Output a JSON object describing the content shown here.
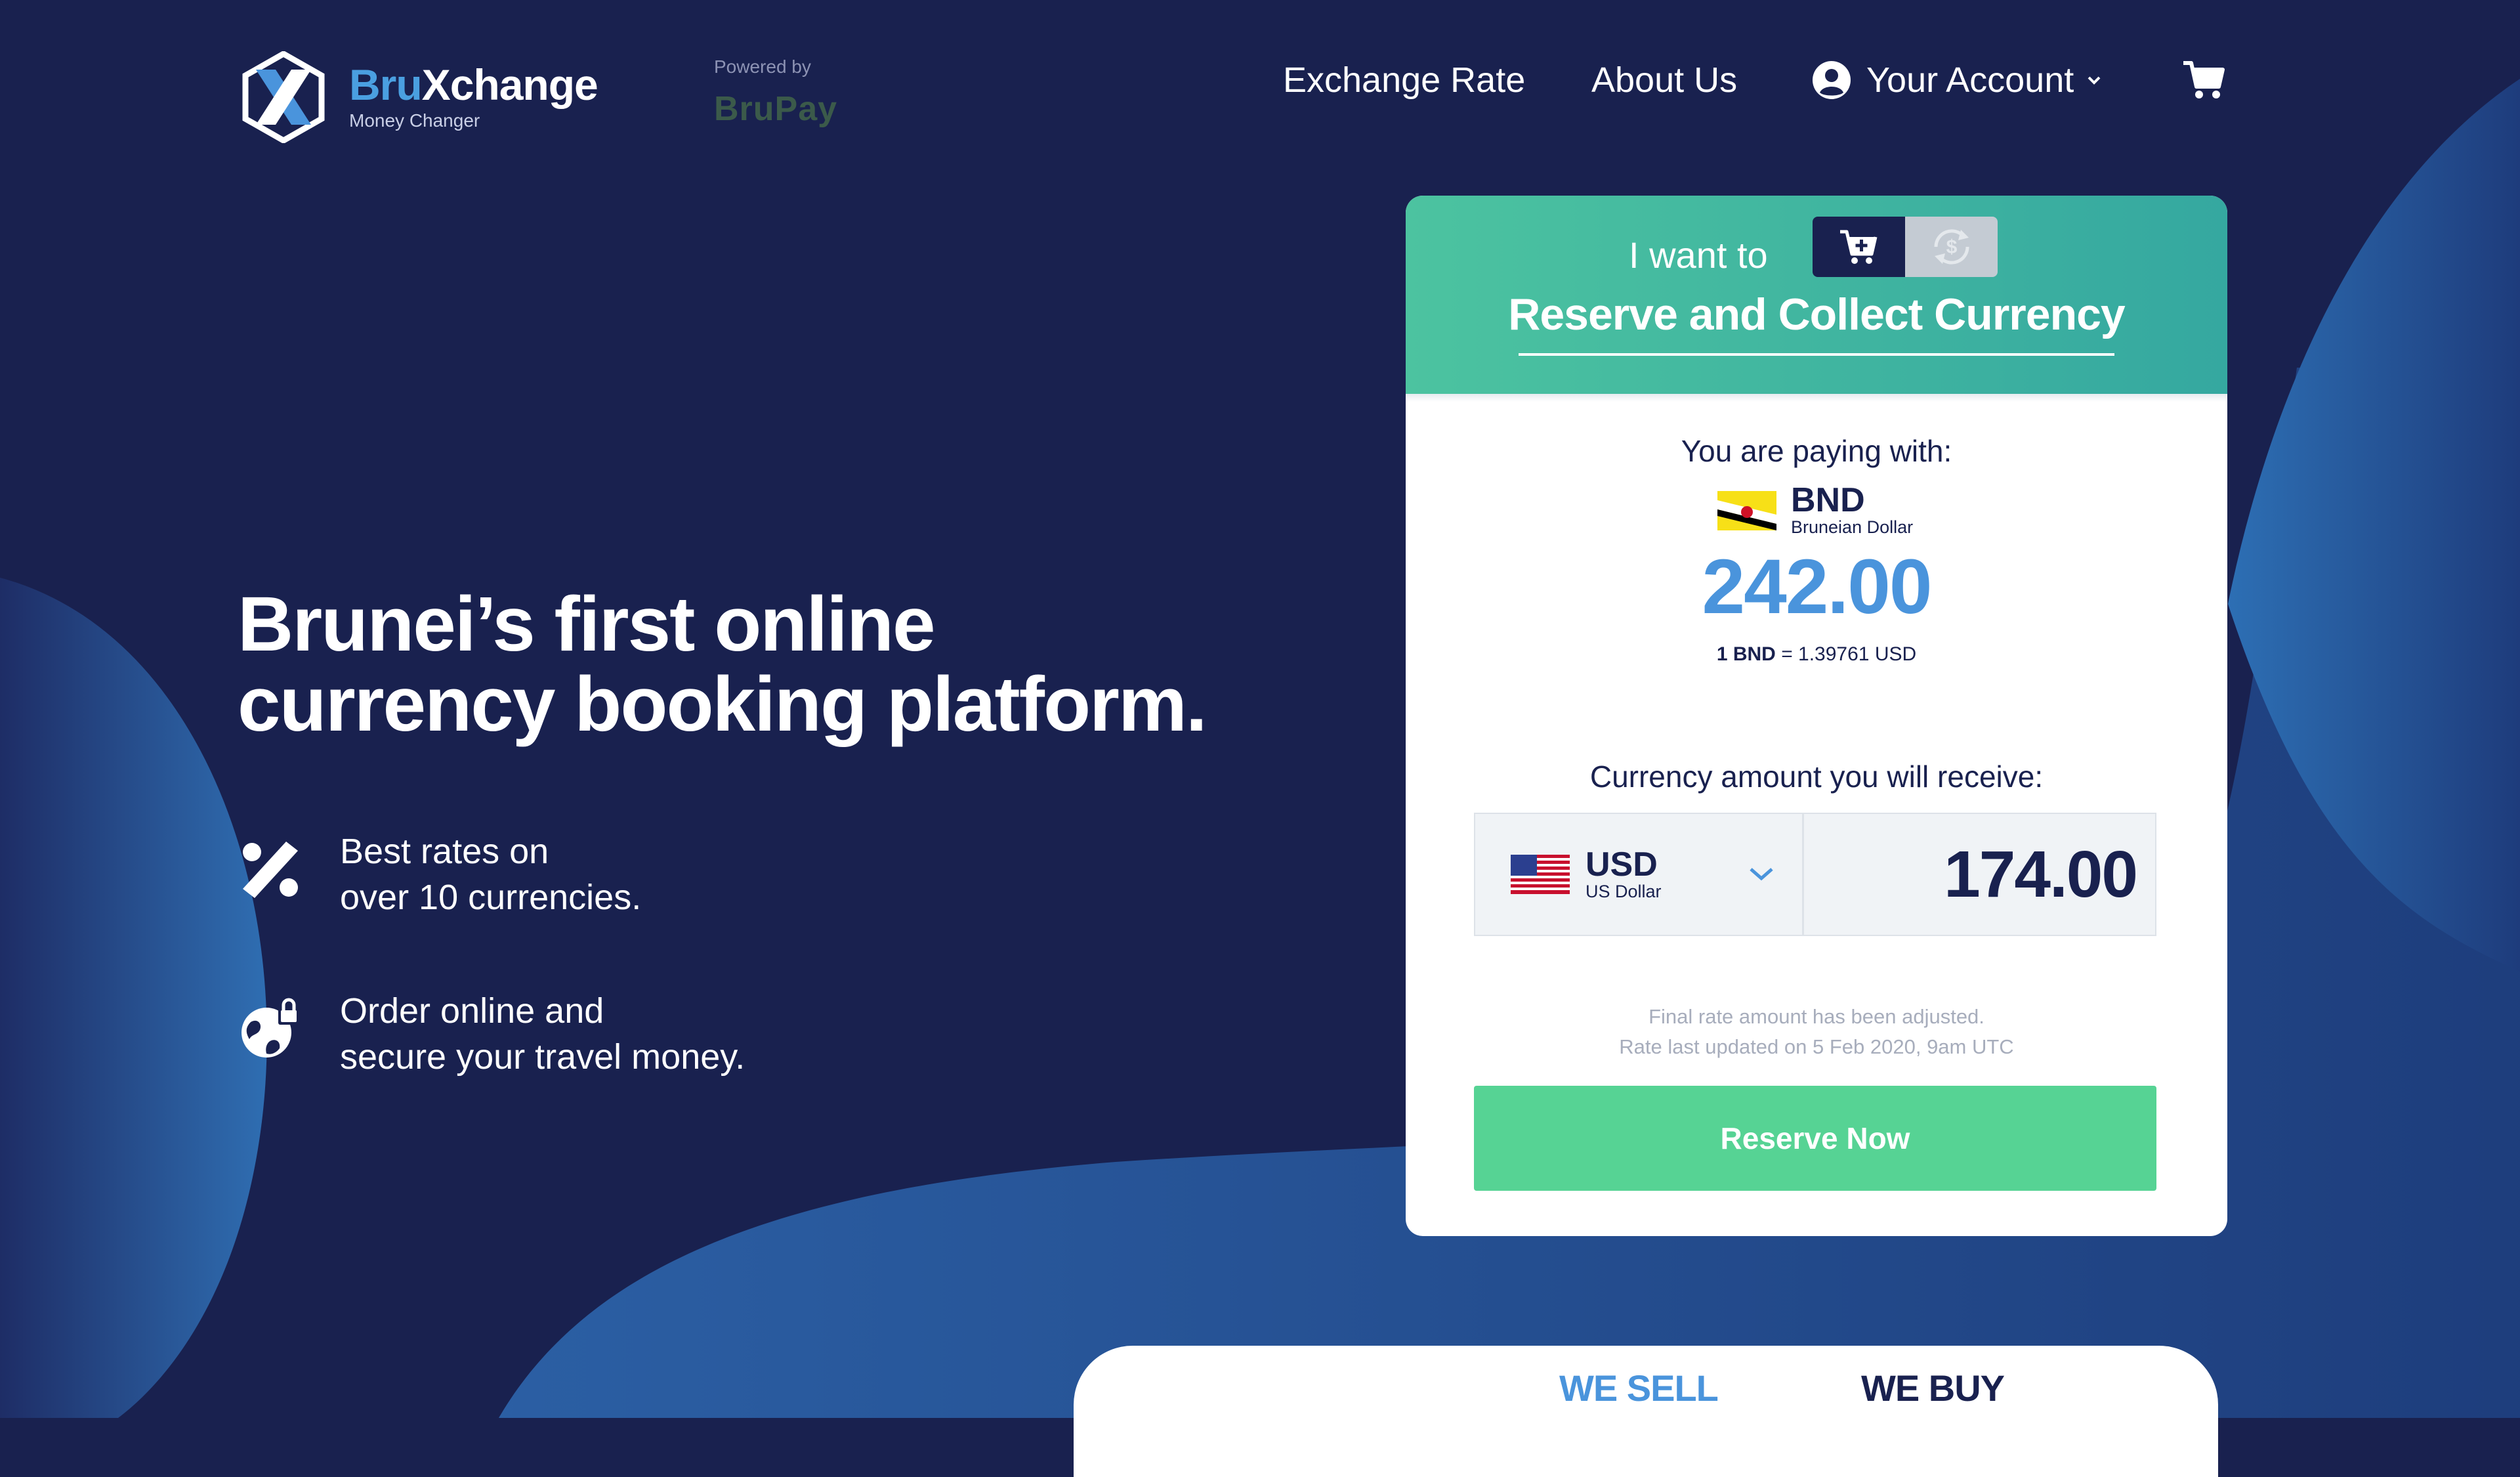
{
  "brand": {
    "name_part1": "Bru",
    "name_part2": "Xchange",
    "subtitle": "Money Changer",
    "powered_label": "Powered by",
    "partner": "BruPay"
  },
  "nav": {
    "exchange_rate": "Exchange Rate",
    "about_us": "About Us",
    "account": "Your Account"
  },
  "hero": {
    "title_line1": "Brunei’s first online",
    "title_line2": "currency booking platform.",
    "features": [
      {
        "icon": "percent-icon",
        "line1": "Best rates on",
        "line2": "over 10 currencies."
      },
      {
        "icon": "secure-globe-icon",
        "line1": "Order online and",
        "line2": "secure your travel money."
      }
    ]
  },
  "card": {
    "i_want_to": "I want to",
    "mode_title": "Reserve and Collect Currency",
    "paying_label": "You are paying with:",
    "paying_currency": {
      "code": "BND",
      "name": "Bruneian Dollar",
      "flag": "brunei-flag"
    },
    "paying_amount": "242.00",
    "rate_base": "1 BND",
    "rate_value": "= 1.39761 USD",
    "receive_label": "Currency amount you will receive:",
    "receive_currency": {
      "code": "USD",
      "name": "US Dollar",
      "flag": "us-flag"
    },
    "receive_amount": "174.00",
    "note_line1": "Final rate amount has been adjusted.",
    "note_line2": "Rate last updated on 5 Feb 2020, 9am UTC",
    "reserve_button": "Reserve Now"
  },
  "rates_tabs": {
    "sell": "WE SELL",
    "buy": "WE BUY"
  },
  "colors": {
    "background": "#19214f",
    "accent_blue": "#4a94dc",
    "accent_green": "#56d394",
    "card_header": "#41b8a0"
  }
}
